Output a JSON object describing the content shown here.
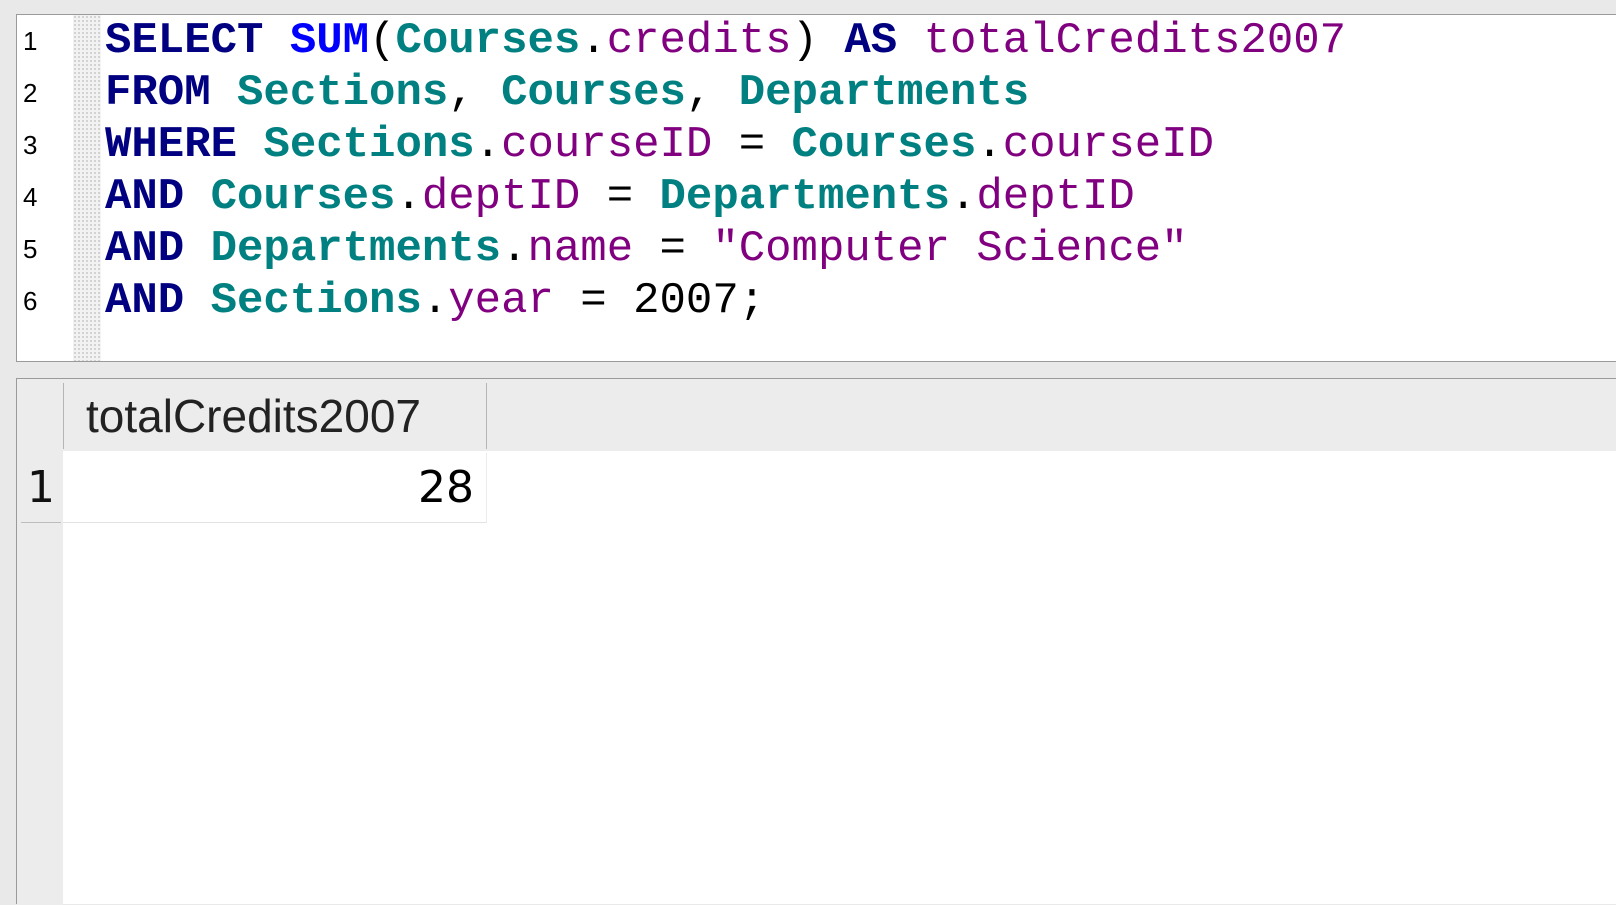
{
  "editor": {
    "line_numbers": [
      "1",
      "2",
      "3",
      "4",
      "5",
      "6"
    ],
    "lines": [
      [
        {
          "t": "SELECT",
          "c": "kw"
        },
        {
          "t": " ",
          "c": "pl"
        },
        {
          "t": "SUM",
          "c": "fn"
        },
        {
          "t": "(",
          "c": "pl"
        },
        {
          "t": "Courses",
          "c": "tbl"
        },
        {
          "t": ".",
          "c": "pl"
        },
        {
          "t": "credits",
          "c": "col"
        },
        {
          "t": ") ",
          "c": "pl"
        },
        {
          "t": "AS",
          "c": "kw"
        },
        {
          "t": " ",
          "c": "pl"
        },
        {
          "t": "totalCredits2007",
          "c": "col"
        }
      ],
      [
        {
          "t": "FROM",
          "c": "kw"
        },
        {
          "t": " ",
          "c": "pl"
        },
        {
          "t": "Sections",
          "c": "tbl"
        },
        {
          "t": ", ",
          "c": "pl"
        },
        {
          "t": "Courses",
          "c": "tbl"
        },
        {
          "t": ", ",
          "c": "pl"
        },
        {
          "t": "Departments",
          "c": "tbl"
        }
      ],
      [
        {
          "t": "WHERE",
          "c": "kw"
        },
        {
          "t": " ",
          "c": "pl"
        },
        {
          "t": "Sections",
          "c": "tbl"
        },
        {
          "t": ".",
          "c": "pl"
        },
        {
          "t": "courseID",
          "c": "col"
        },
        {
          "t": " = ",
          "c": "pl"
        },
        {
          "t": "Courses",
          "c": "tbl"
        },
        {
          "t": ".",
          "c": "pl"
        },
        {
          "t": "courseID",
          "c": "col"
        }
      ],
      [
        {
          "t": "AND",
          "c": "kw"
        },
        {
          "t": " ",
          "c": "pl"
        },
        {
          "t": "Courses",
          "c": "tbl"
        },
        {
          "t": ".",
          "c": "pl"
        },
        {
          "t": "deptID",
          "c": "col"
        },
        {
          "t": " = ",
          "c": "pl"
        },
        {
          "t": "Departments",
          "c": "tbl"
        },
        {
          "t": ".",
          "c": "pl"
        },
        {
          "t": "deptID",
          "c": "col"
        }
      ],
      [
        {
          "t": "AND",
          "c": "kw"
        },
        {
          "t": " ",
          "c": "pl"
        },
        {
          "t": "Departments",
          "c": "tbl"
        },
        {
          "t": ".",
          "c": "pl"
        },
        {
          "t": "name",
          "c": "col"
        },
        {
          "t": " = ",
          "c": "pl"
        },
        {
          "t": "\"Computer Science\"",
          "c": "str"
        }
      ],
      [
        {
          "t": "AND",
          "c": "kw"
        },
        {
          "t": " ",
          "c": "pl"
        },
        {
          "t": "Sections",
          "c": "tbl"
        },
        {
          "t": ".",
          "c": "pl"
        },
        {
          "t": "year",
          "c": "col"
        },
        {
          "t": " = ",
          "c": "pl"
        },
        {
          "t": "2007",
          "c": "num"
        },
        {
          "t": ";",
          "c": "pl"
        }
      ]
    ],
    "colors": {
      "keyword": "#000080",
      "function": "#0000ff",
      "table": "#008080",
      "column": "#800080",
      "string": "#800080"
    }
  },
  "results": {
    "columns": [
      "totalCredits2007"
    ],
    "rows": [
      {
        "num": "1",
        "cells": [
          "28"
        ]
      }
    ]
  }
}
